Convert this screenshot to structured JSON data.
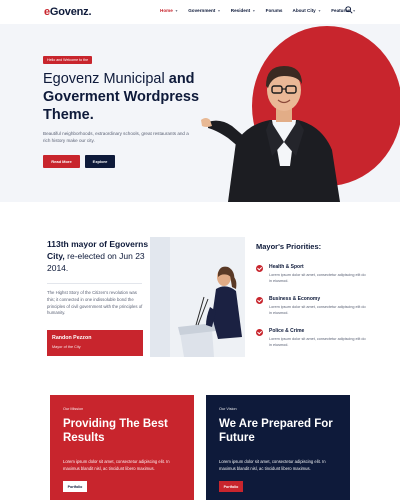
{
  "brand": {
    "logo_prefix": "e",
    "logo_rest": "Govenz."
  },
  "nav": {
    "items": [
      {
        "label": "Home",
        "dropdown": true,
        "active": true
      },
      {
        "label": "Government",
        "dropdown": true
      },
      {
        "label": "Resident",
        "dropdown": true
      },
      {
        "label": "Forums",
        "dropdown": false
      },
      {
        "label": "About City",
        "dropdown": true
      },
      {
        "label": "Features",
        "dropdown": true
      }
    ],
    "search_icon": "search-icon"
  },
  "hero": {
    "badge": "Hello and Welcome to the",
    "title_light": "Egovenz Municipal ",
    "title_bold_1": "and",
    "title_bold_2": "Goverment Wordpress Theme.",
    "description": "Beautiful neighborhoods, extraordinary schools, great restaurants and a rich history make our city.",
    "btn_primary": "Read More",
    "btn_secondary": "Explore"
  },
  "mayor": {
    "heading_bold": "113th mayor of Egoverns City,",
    "heading_rest": " re-elected on Jun 23 2014.",
    "description": "The Highst Story of the Citizen's revolution was this; it connected in one indissoluble bond the principles of civil government with the principles of humanity.",
    "name": "Randon Pezzon",
    "role": "Mayor of the City"
  },
  "priorities": {
    "title": "Mayor's Priorities:",
    "items": [
      {
        "name": "Health & Sport",
        "desc": "Lorem ipsum dolor sit amet, consectetur adipiscing elit do in eiusmod."
      },
      {
        "name": "Business & Economy",
        "desc": "Lorem ipsum dolor sit amet, consectetur adipiscing elit do in eiusmod."
      },
      {
        "name": "Police & Crime",
        "desc": "Lorem ipsum dolor sit amet, consectetur adipiscing elit do in eiusmod."
      }
    ]
  },
  "cards": [
    {
      "kicker": "Our Mission",
      "title": "Providing The Best Results",
      "text": "Lorem ipsum dolor sit amet, consectetur adipiscing elit. In maximus blandit nisl, ac tincidunt libero maximus.",
      "button": "Portfolio"
    },
    {
      "kicker": "Our Vision",
      "title": "We Are Prepared For Future",
      "text": "Lorem ipsum dolor sit amet, consectetur adipiscing elit. In maximus blandit nisl, ac tincidunt libero maximus.",
      "button": "Portfolio"
    }
  ],
  "colors": {
    "accent": "#c8252d",
    "navy": "#0e1a3a",
    "hero_bg": "#f3f5f9"
  }
}
